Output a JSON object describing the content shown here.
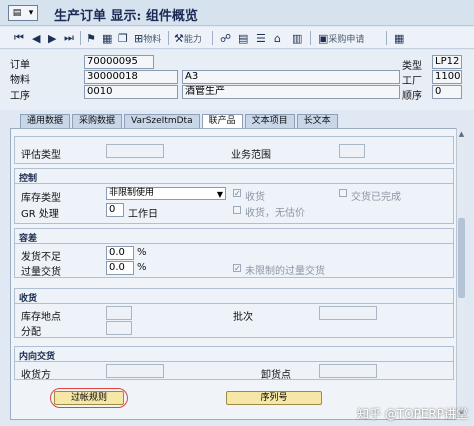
{
  "window": {
    "title": "生产订单 显示: 组件概览"
  },
  "toolbar": {
    "nav_icons": [
      "first-icon",
      "prev-icon",
      "next-icon",
      "last-icon"
    ],
    "material_label": "物料",
    "capacity_label": "能力",
    "purchase_req_label": "采购申请"
  },
  "header": {
    "order_label": "订单",
    "order_value": "70000095",
    "type_label": "类型",
    "type_value": "LP12",
    "material_label": "物料",
    "material_value": "30000018",
    "material_desc": "A3",
    "plant_label": "工厂",
    "plant_value": "1100",
    "operation_label": "工序",
    "operation_value": "0010",
    "operation_desc": "酒管生产",
    "sequence_label": "顺序",
    "sequence_value": "0"
  },
  "tabs": [
    {
      "label": "通用数据",
      "active": false
    },
    {
      "label": "采购数据",
      "active": false
    },
    {
      "label": "VarSzeItmDta",
      "active": false
    },
    {
      "label": "联产品",
      "active": true
    },
    {
      "label": "文本项目",
      "active": false
    },
    {
      "label": "长文本",
      "active": false
    }
  ],
  "costing": {
    "valuation_type_label": "评估类型",
    "valuation_type_value": "",
    "business_area_label": "业务范围",
    "business_area_value": ""
  },
  "control": {
    "title": "控制",
    "stock_type_label": "库存类型",
    "stock_type_value": "非限制使用",
    "gr_processing_label": "GR 处理",
    "gr_processing_value": "0",
    "workday_label": "工作日",
    "gr_label": "收货",
    "gr_checked": true,
    "delivery_complete_label": "交货已完成",
    "delivery_complete_checked": false,
    "gr_nonvaluated_label": "收货，无估价",
    "gr_nonvaluated_checked": false
  },
  "tolerance": {
    "title": "容差",
    "underdelivery_label": "发货不足",
    "underdelivery_value": "0.0",
    "underdelivery_unit": "%",
    "overdelivery_label": "过量交货",
    "overdelivery_value": "0.0",
    "overdelivery_unit": "%",
    "unlimited_over_label": "未限制的过量交货",
    "unlimited_over_checked": true
  },
  "goods_receipt": {
    "title": "收货",
    "storage_location_label": "库存地点",
    "storage_location_value": "",
    "batch_label": "批次",
    "batch_value": "",
    "distribution_label": "分配",
    "distribution_value": ""
  },
  "inbound": {
    "title": "内向交货",
    "recipient_label": "收货方",
    "recipient_value": "",
    "unloading_point_label": "卸货点",
    "unloading_point_value": ""
  },
  "buttons": {
    "settlement_rule": "过帐规则",
    "serial_number": "序列号"
  },
  "watermark": "知乎 @TOPERP讲堂",
  "colors": {
    "highlight": "#e0443a",
    "button": "#f6e7a6",
    "panel": "#f0f4f9"
  }
}
